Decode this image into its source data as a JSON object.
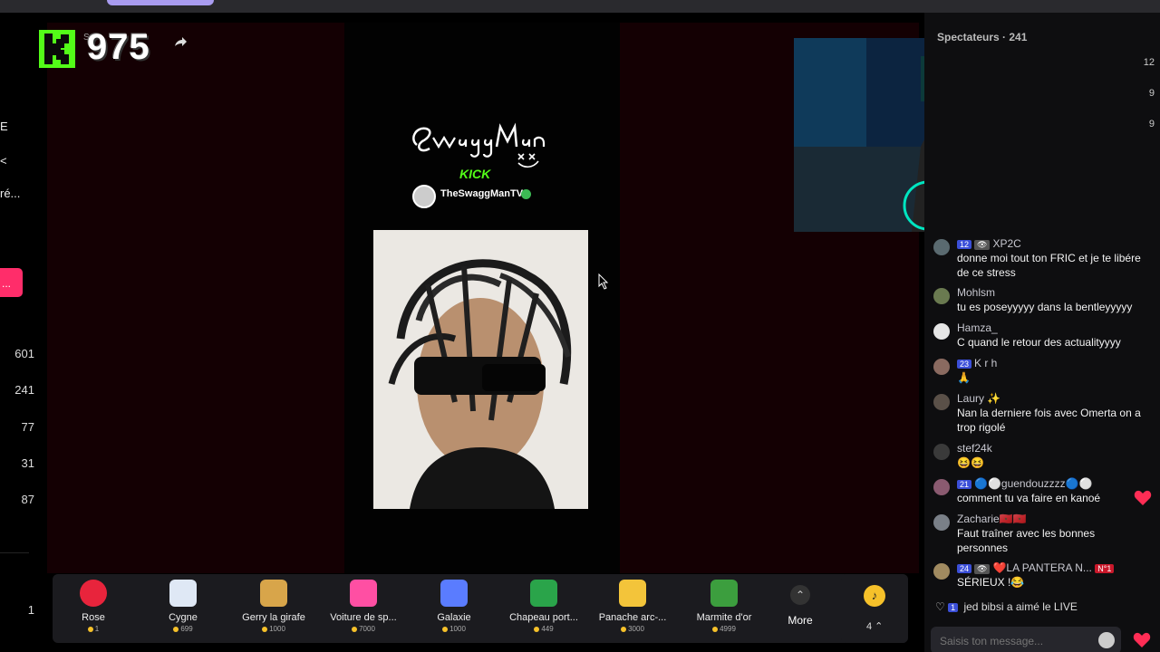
{
  "overlay": {
    "count": "975",
    "tag": "S"
  },
  "leftnav": {
    "fragments": [
      "E",
      "<",
      "ré..."
    ],
    "pink_label": "..."
  },
  "leftnav_counts": [
    "601",
    "241",
    "77",
    "31",
    "87",
    "1"
  ],
  "promo": {
    "handle": "TheSwaggManTV",
    "kick_label": "KICK"
  },
  "chat": {
    "viewers_label": "Spectateurs · 241",
    "side_counts": [
      "12",
      "9",
      "9"
    ],
    "messages": [
      {
        "badges": [
          "12",
          "👁"
        ],
        "user": "XP2C",
        "text": "donne moi tout ton FRIC et je te libére de ce stress"
      },
      {
        "badges": [],
        "user": "Mohlsm",
        "text": "tu es poseyyyyy dans la bentleyyyyy"
      },
      {
        "badges": [],
        "user": "Hamza_",
        "text": "C quand le retour des actualityyyy"
      },
      {
        "badges": [
          "23"
        ],
        "user": "K r h",
        "text": "🙏"
      },
      {
        "badges": [],
        "user": "Laury ✨",
        "text": "Nan la derniere fois avec Omerta on a trop rigolé"
      },
      {
        "badges": [],
        "user": "stef24k",
        "text": "😆😆"
      },
      {
        "badges": [
          "21"
        ],
        "user": "🔵⚪guendouzzzz🔵⚪",
        "text": "comment tu va faire en kanoé"
      },
      {
        "badges": [],
        "user": "Zacharie🇲🇦🇲🇦",
        "text": "Faut traîner avec les bonnes personnes"
      },
      {
        "badges": [
          "24",
          "👁"
        ],
        "user": "❤️LA PANTERA N...",
        "extra_badge": "N°1",
        "text": "SÉRIEUX !😂"
      }
    ],
    "like_line": {
      "badge": "1",
      "user": "jed bibsi",
      "action": "a aimé le LIVE"
    },
    "input_placeholder": "Saisis ton message..."
  },
  "gifts": [
    {
      "name": "Rose",
      "price": "1",
      "color": "#e8243c"
    },
    {
      "name": "Cygne",
      "price": "699",
      "color": "#dfe8f5"
    },
    {
      "name": "Gerry la girafe",
      "price": "1000",
      "color": "#d8a54a"
    },
    {
      "name": "Voiture de sp...",
      "price": "7000",
      "color": "#ff4fa3"
    },
    {
      "name": "Galaxie",
      "price": "1000",
      "color": "#5a7cff"
    },
    {
      "name": "Chapeau port...",
      "price": "449",
      "color": "#2aa44a"
    },
    {
      "name": "Panache arc-...",
      "price": "3000",
      "color": "#f3c43a"
    },
    {
      "name": "Marmite d'or",
      "price": "4999",
      "color": "#3c9e3e"
    }
  ],
  "more_label": "More",
  "coin_count": "4"
}
